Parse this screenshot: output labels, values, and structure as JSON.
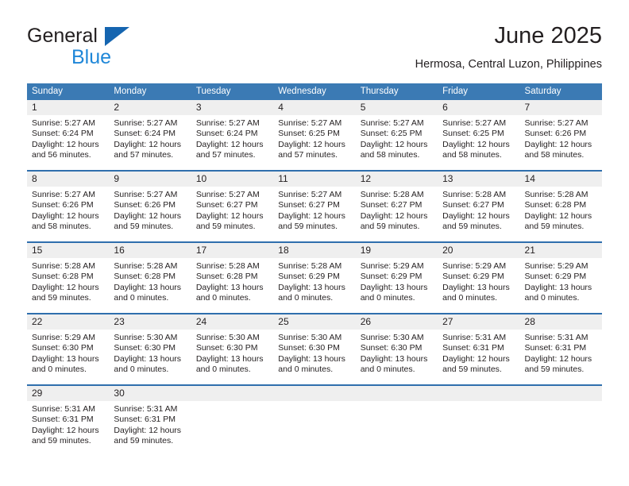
{
  "brand": {
    "name_part1": "General",
    "name_part2": "Blue",
    "triangle_color": "#1565b0",
    "blue_color": "#1f87d8"
  },
  "header": {
    "title": "June 2025",
    "subtitle": "Hermosa, Central Luzon, Philippines"
  },
  "theme": {
    "header_blue": "#3b7ab4",
    "row_divider_blue": "#2f6fad",
    "daynum_band": "#efefef"
  },
  "weekdays": [
    "Sunday",
    "Monday",
    "Tuesday",
    "Wednesday",
    "Thursday",
    "Friday",
    "Saturday"
  ],
  "weeks": [
    [
      {
        "day": "1",
        "sunrise": "Sunrise: 5:27 AM",
        "sunset": "Sunset: 6:24 PM",
        "daylight1": "Daylight: 12 hours",
        "daylight2": "and 56 minutes."
      },
      {
        "day": "2",
        "sunrise": "Sunrise: 5:27 AM",
        "sunset": "Sunset: 6:24 PM",
        "daylight1": "Daylight: 12 hours",
        "daylight2": "and 57 minutes."
      },
      {
        "day": "3",
        "sunrise": "Sunrise: 5:27 AM",
        "sunset": "Sunset: 6:24 PM",
        "daylight1": "Daylight: 12 hours",
        "daylight2": "and 57 minutes."
      },
      {
        "day": "4",
        "sunrise": "Sunrise: 5:27 AM",
        "sunset": "Sunset: 6:25 PM",
        "daylight1": "Daylight: 12 hours",
        "daylight2": "and 57 minutes."
      },
      {
        "day": "5",
        "sunrise": "Sunrise: 5:27 AM",
        "sunset": "Sunset: 6:25 PM",
        "daylight1": "Daylight: 12 hours",
        "daylight2": "and 58 minutes."
      },
      {
        "day": "6",
        "sunrise": "Sunrise: 5:27 AM",
        "sunset": "Sunset: 6:25 PM",
        "daylight1": "Daylight: 12 hours",
        "daylight2": "and 58 minutes."
      },
      {
        "day": "7",
        "sunrise": "Sunrise: 5:27 AM",
        "sunset": "Sunset: 6:26 PM",
        "daylight1": "Daylight: 12 hours",
        "daylight2": "and 58 minutes."
      }
    ],
    [
      {
        "day": "8",
        "sunrise": "Sunrise: 5:27 AM",
        "sunset": "Sunset: 6:26 PM",
        "daylight1": "Daylight: 12 hours",
        "daylight2": "and 58 minutes."
      },
      {
        "day": "9",
        "sunrise": "Sunrise: 5:27 AM",
        "sunset": "Sunset: 6:26 PM",
        "daylight1": "Daylight: 12 hours",
        "daylight2": "and 59 minutes."
      },
      {
        "day": "10",
        "sunrise": "Sunrise: 5:27 AM",
        "sunset": "Sunset: 6:27 PM",
        "daylight1": "Daylight: 12 hours",
        "daylight2": "and 59 minutes."
      },
      {
        "day": "11",
        "sunrise": "Sunrise: 5:27 AM",
        "sunset": "Sunset: 6:27 PM",
        "daylight1": "Daylight: 12 hours",
        "daylight2": "and 59 minutes."
      },
      {
        "day": "12",
        "sunrise": "Sunrise: 5:28 AM",
        "sunset": "Sunset: 6:27 PM",
        "daylight1": "Daylight: 12 hours",
        "daylight2": "and 59 minutes."
      },
      {
        "day": "13",
        "sunrise": "Sunrise: 5:28 AM",
        "sunset": "Sunset: 6:27 PM",
        "daylight1": "Daylight: 12 hours",
        "daylight2": "and 59 minutes."
      },
      {
        "day": "14",
        "sunrise": "Sunrise: 5:28 AM",
        "sunset": "Sunset: 6:28 PM",
        "daylight1": "Daylight: 12 hours",
        "daylight2": "and 59 minutes."
      }
    ],
    [
      {
        "day": "15",
        "sunrise": "Sunrise: 5:28 AM",
        "sunset": "Sunset: 6:28 PM",
        "daylight1": "Daylight: 12 hours",
        "daylight2": "and 59 minutes."
      },
      {
        "day": "16",
        "sunrise": "Sunrise: 5:28 AM",
        "sunset": "Sunset: 6:28 PM",
        "daylight1": "Daylight: 13 hours",
        "daylight2": "and 0 minutes."
      },
      {
        "day": "17",
        "sunrise": "Sunrise: 5:28 AM",
        "sunset": "Sunset: 6:28 PM",
        "daylight1": "Daylight: 13 hours",
        "daylight2": "and 0 minutes."
      },
      {
        "day": "18",
        "sunrise": "Sunrise: 5:28 AM",
        "sunset": "Sunset: 6:29 PM",
        "daylight1": "Daylight: 13 hours",
        "daylight2": "and 0 minutes."
      },
      {
        "day": "19",
        "sunrise": "Sunrise: 5:29 AM",
        "sunset": "Sunset: 6:29 PM",
        "daylight1": "Daylight: 13 hours",
        "daylight2": "and 0 minutes."
      },
      {
        "day": "20",
        "sunrise": "Sunrise: 5:29 AM",
        "sunset": "Sunset: 6:29 PM",
        "daylight1": "Daylight: 13 hours",
        "daylight2": "and 0 minutes."
      },
      {
        "day": "21",
        "sunrise": "Sunrise: 5:29 AM",
        "sunset": "Sunset: 6:29 PM",
        "daylight1": "Daylight: 13 hours",
        "daylight2": "and 0 minutes."
      }
    ],
    [
      {
        "day": "22",
        "sunrise": "Sunrise: 5:29 AM",
        "sunset": "Sunset: 6:30 PM",
        "daylight1": "Daylight: 13 hours",
        "daylight2": "and 0 minutes."
      },
      {
        "day": "23",
        "sunrise": "Sunrise: 5:30 AM",
        "sunset": "Sunset: 6:30 PM",
        "daylight1": "Daylight: 13 hours",
        "daylight2": "and 0 minutes."
      },
      {
        "day": "24",
        "sunrise": "Sunrise: 5:30 AM",
        "sunset": "Sunset: 6:30 PM",
        "daylight1": "Daylight: 13 hours",
        "daylight2": "and 0 minutes."
      },
      {
        "day": "25",
        "sunrise": "Sunrise: 5:30 AM",
        "sunset": "Sunset: 6:30 PM",
        "daylight1": "Daylight: 13 hours",
        "daylight2": "and 0 minutes."
      },
      {
        "day": "26",
        "sunrise": "Sunrise: 5:30 AM",
        "sunset": "Sunset: 6:30 PM",
        "daylight1": "Daylight: 13 hours",
        "daylight2": "and 0 minutes."
      },
      {
        "day": "27",
        "sunrise": "Sunrise: 5:31 AM",
        "sunset": "Sunset: 6:31 PM",
        "daylight1": "Daylight: 12 hours",
        "daylight2": "and 59 minutes."
      },
      {
        "day": "28",
        "sunrise": "Sunrise: 5:31 AM",
        "sunset": "Sunset: 6:31 PM",
        "daylight1": "Daylight: 12 hours",
        "daylight2": "and 59 minutes."
      }
    ],
    [
      {
        "day": "29",
        "sunrise": "Sunrise: 5:31 AM",
        "sunset": "Sunset: 6:31 PM",
        "daylight1": "Daylight: 12 hours",
        "daylight2": "and 59 minutes."
      },
      {
        "day": "30",
        "sunrise": "Sunrise: 5:31 AM",
        "sunset": "Sunset: 6:31 PM",
        "daylight1": "Daylight: 12 hours",
        "daylight2": "and 59 minutes."
      },
      {
        "day": "",
        "sunrise": "",
        "sunset": "",
        "daylight1": "",
        "daylight2": ""
      },
      {
        "day": "",
        "sunrise": "",
        "sunset": "",
        "daylight1": "",
        "daylight2": ""
      },
      {
        "day": "",
        "sunrise": "",
        "sunset": "",
        "daylight1": "",
        "daylight2": ""
      },
      {
        "day": "",
        "sunrise": "",
        "sunset": "",
        "daylight1": "",
        "daylight2": ""
      },
      {
        "day": "",
        "sunrise": "",
        "sunset": "",
        "daylight1": "",
        "daylight2": ""
      }
    ]
  ]
}
